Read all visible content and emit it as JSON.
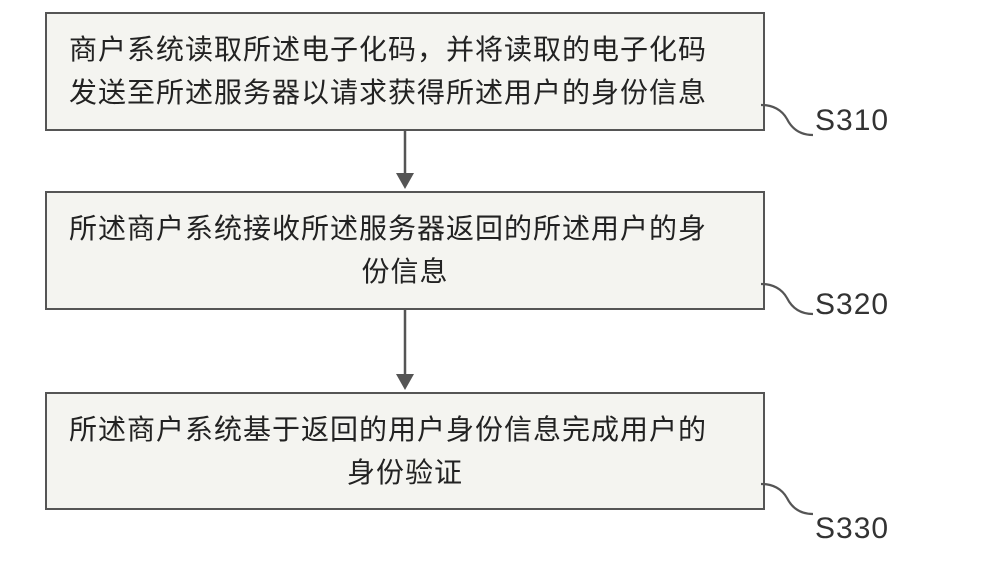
{
  "steps": [
    {
      "id": "S310",
      "line1": "商户系统读取所述电子化码，并将读取的电子化码",
      "line2": "发送至所述服务器以请求获得所述用户的身份信息"
    },
    {
      "id": "S320",
      "line1": "所述商户系统接收所述服务器返回的所述用户的身",
      "line2": "份信息"
    },
    {
      "id": "S330",
      "line1": "所述商户系统基于返回的用户身份信息完成用户的",
      "line2": "身份验证"
    }
  ]
}
